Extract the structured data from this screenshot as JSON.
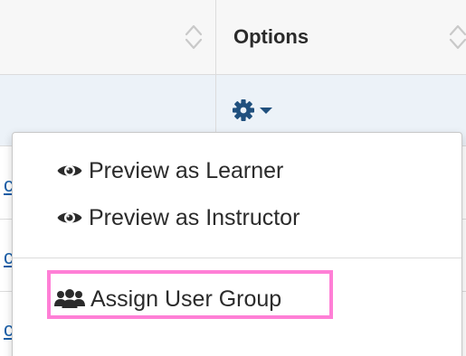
{
  "table": {
    "header": {
      "columns": [
        {
          "label": "",
          "sortable": true
        },
        {
          "label": "Options",
          "sortable": true
        }
      ]
    },
    "options_toggle": {
      "icon": "gear-icon",
      "caret": "caret-down-icon"
    },
    "row_link_fragment": "c"
  },
  "dropdown": {
    "items": [
      {
        "label": "Preview as Learner",
        "icon": "eye-icon"
      },
      {
        "label": "Preview as Instructor",
        "icon": "eye-icon"
      },
      {
        "label": "Assign User Group",
        "icon": "users-icon",
        "highlighted": true
      }
    ]
  },
  "colors": {
    "link": "#1a5fa8",
    "header_bg": "#f7f7f7",
    "active_row_bg": "#ecf2f8",
    "gear": "#20507e",
    "highlight": "#ff7fd6"
  }
}
